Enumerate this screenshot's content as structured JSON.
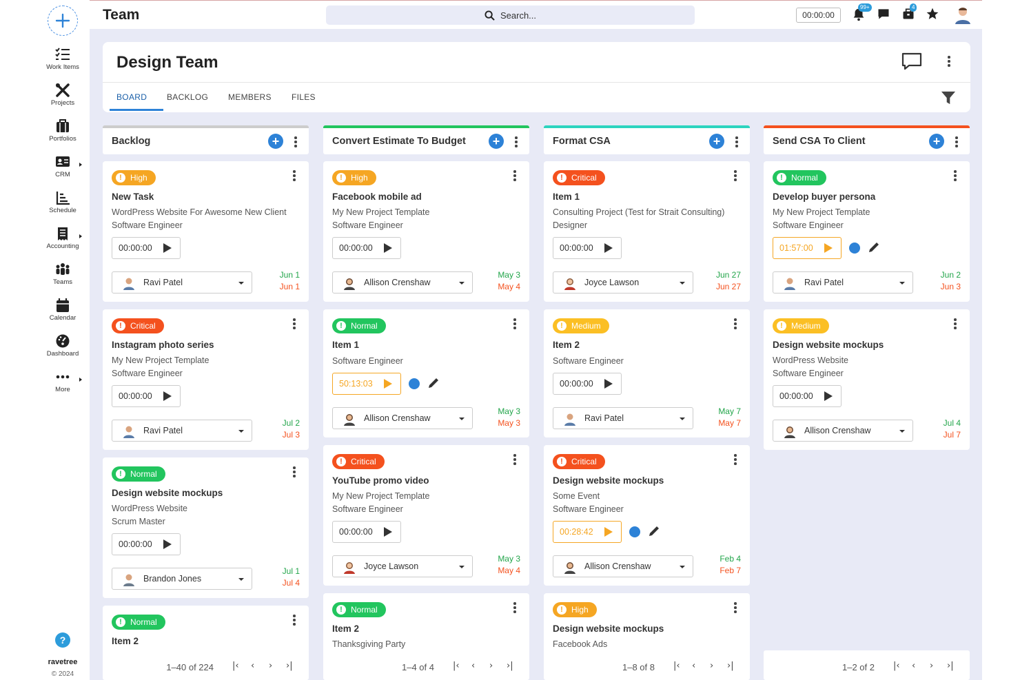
{
  "app": {
    "section_title": "Team",
    "search_placeholder": "Search...",
    "top_timer": "00:00:00",
    "notification_badge": "99+",
    "bag_badge": "4"
  },
  "sidebar": {
    "items": [
      {
        "label": "Work Items",
        "icon": "work-items-icon"
      },
      {
        "label": "Projects",
        "icon": "projects-icon"
      },
      {
        "label": "Portfolios",
        "icon": "portfolios-icon"
      },
      {
        "label": "CRM",
        "icon": "crm-icon"
      },
      {
        "label": "Schedule",
        "icon": "schedule-icon"
      },
      {
        "label": "Accounting",
        "icon": "accounting-icon"
      },
      {
        "label": "Teams",
        "icon": "teams-icon"
      },
      {
        "label": "Calendar",
        "icon": "calendar-icon"
      },
      {
        "label": "Dashboard",
        "icon": "dashboard-icon"
      },
      {
        "label": "More",
        "icon": "more-icon"
      }
    ],
    "help": "?",
    "brand": "ravetree",
    "copyright": "© 2024"
  },
  "page": {
    "title": "Design Team",
    "tabs": [
      "BOARD",
      "BACKLOG",
      "MEMBERS",
      "FILES"
    ],
    "active_tab": "BOARD"
  },
  "colors": {
    "high": "#f5a623",
    "critical": "#f4511e",
    "normal": "#22c55e",
    "medium": "#fbbf24",
    "accent": "#2d82d7"
  },
  "columns": [
    {
      "title": "Backlog",
      "accent": "#cccccc",
      "pager": "1–40 of 224",
      "cards": [
        {
          "priority": "High",
          "title": "New Task",
          "line1": "WordPress Website For Awesome New Client",
          "line2": "Software Engineer",
          "timer": "00:00:00",
          "assignee": "Ravi Patel",
          "start": "Jun 1",
          "end": "Jun 1"
        },
        {
          "priority": "Critical",
          "title": "Instagram photo series",
          "line1": "My New Project Template",
          "line2": "Software Engineer",
          "timer": "00:00:00",
          "assignee": "Ravi Patel",
          "start": "Jul 2",
          "end": "Jul 3"
        },
        {
          "priority": "Normal",
          "title": "Design website mockups",
          "line1": "WordPress Website",
          "line2": "Scrum Master",
          "timer": "00:00:00",
          "assignee": "Brandon Jones",
          "start": "Jul 1",
          "end": "Jul 4"
        },
        {
          "priority": "Normal",
          "title": "Item 2"
        }
      ]
    },
    {
      "title": "Convert Estimate To Budget",
      "accent": "#22c55e",
      "pager": "1–4 of 4",
      "cards": [
        {
          "priority": "High",
          "title": "Facebook mobile ad",
          "line1": "My New Project Template",
          "line2": "Software Engineer",
          "timer": "00:00:00",
          "assignee": "Allison Crenshaw",
          "start": "May 3",
          "end": "May 4"
        },
        {
          "priority": "Normal",
          "title": "Item 1",
          "line1": "Software Engineer",
          "timer": "50:13:03",
          "assignee": "Allison Crenshaw",
          "start": "May 3",
          "end": "May 3"
        },
        {
          "priority": "Critical",
          "title": "YouTube promo video",
          "line1": "My New Project Template",
          "line2": "Software Engineer",
          "timer": "00:00:00",
          "assignee": "Joyce Lawson",
          "start": "May 3",
          "end": "May 4"
        },
        {
          "priority": "Normal",
          "title": "Item 2",
          "line1": "Thanksgiving Party"
        }
      ]
    },
    {
      "title": "Format CSA",
      "accent": "#2dd4bf",
      "pager": "1–8 of 8",
      "cards": [
        {
          "priority": "Critical",
          "title": "Item 1",
          "line1": "Consulting Project (Test for Strait Consulting)",
          "line2": "Designer",
          "timer": "00:00:00",
          "assignee": "Joyce Lawson",
          "start": "Jun 27",
          "end": "Jun 27"
        },
        {
          "priority": "Medium",
          "title": "Item 2",
          "line1": "Software Engineer",
          "timer": "00:00:00",
          "assignee": "Ravi Patel",
          "start": "May 7",
          "end": "May 7"
        },
        {
          "priority": "Critical",
          "title": "Design website mockups",
          "line1": "Some Event",
          "line2": "Software Engineer",
          "timer": "00:28:42",
          "assignee": "Allison Crenshaw",
          "start": "Feb 4",
          "end": "Feb 7"
        },
        {
          "priority": "High",
          "title": "Design website mockups",
          "line1": "Facebook Ads"
        }
      ]
    },
    {
      "title": "Send CSA To Client",
      "accent": "#f4511e",
      "pager": "1–2 of 2",
      "cards": [
        {
          "priority": "Normal",
          "title": "Develop buyer persona",
          "line1": "My New Project Template",
          "line2": "Software Engineer",
          "timer": "01:57:00",
          "assignee": "Ravi Patel",
          "start": "Jun 2",
          "end": "Jun 3"
        },
        {
          "priority": "Medium",
          "title": "Design website mockups",
          "line1": "WordPress Website",
          "line2": "Software Engineer",
          "timer": "00:00:00",
          "assignee": "Allison Crenshaw",
          "start": "Jul 4",
          "end": "Jul 7"
        }
      ]
    }
  ]
}
